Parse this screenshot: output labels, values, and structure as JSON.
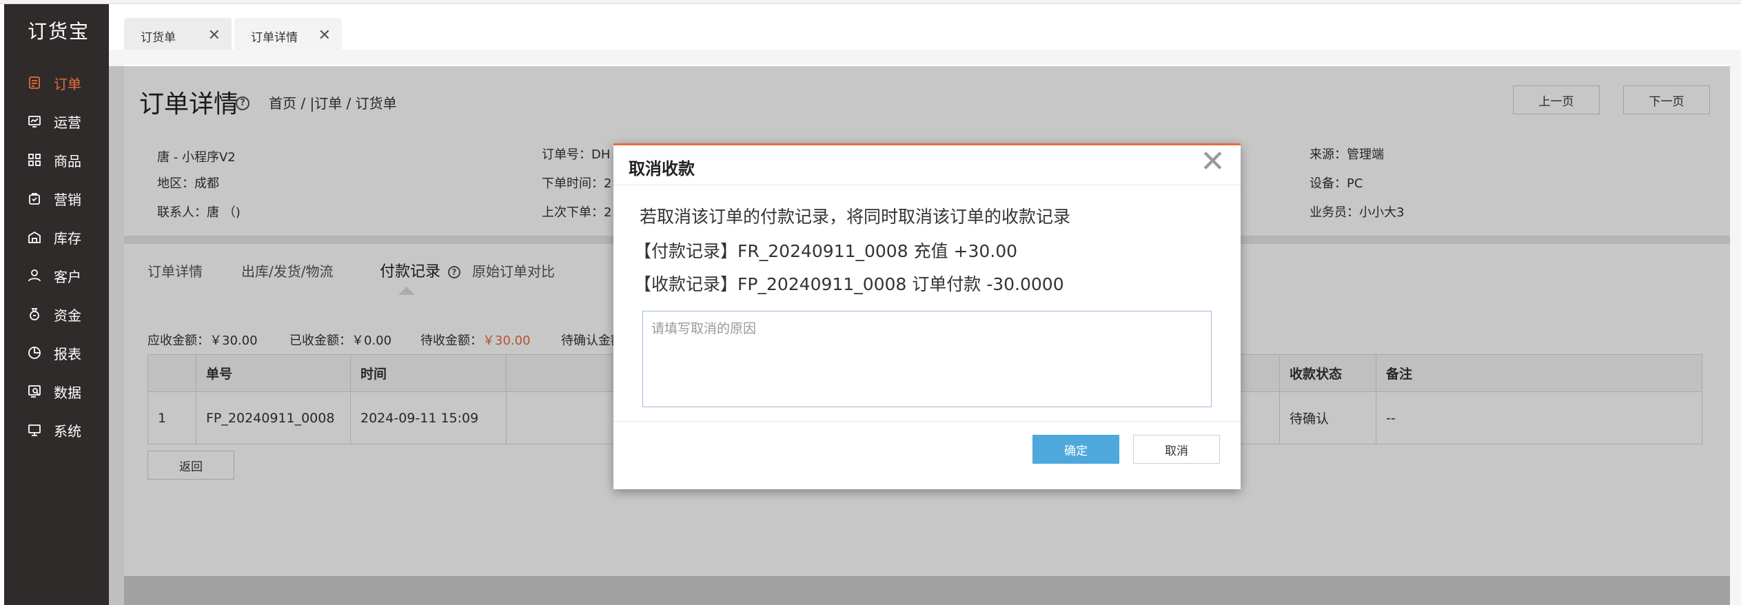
{
  "app": {
    "logo": "订货宝"
  },
  "sidebar": {
    "items": [
      {
        "label": "订单",
        "icon": "order-doc-icon",
        "active": true
      },
      {
        "label": "运营",
        "icon": "operation-chart-icon"
      },
      {
        "label": "商品",
        "icon": "product-grid-icon"
      },
      {
        "label": "营销",
        "icon": "marketing-bag-icon"
      },
      {
        "label": "库存",
        "icon": "warehouse-icon"
      },
      {
        "label": "客户",
        "icon": "customer-user-icon"
      },
      {
        "label": "资金",
        "icon": "money-bag-icon"
      },
      {
        "label": "报表",
        "icon": "report-pie-icon"
      },
      {
        "label": "数据",
        "icon": "data-search-icon"
      },
      {
        "label": "系统",
        "icon": "system-monitor-icon"
      }
    ]
  },
  "tabs": [
    {
      "label": "订货单",
      "close": "✕"
    },
    {
      "label": "订单详情",
      "close": "✕"
    }
  ],
  "page": {
    "title": "订单详情",
    "help": "?",
    "breadcrumb": "首页 / |订单 / 订货单",
    "prev_label": "上一页",
    "next_label": "下一页"
  },
  "info": {
    "customer": "唐 - 小程序V2",
    "region": "地区：成都",
    "contact": "联系人：唐 （)",
    "order_no": "订单号：DH",
    "order_time": "下单时间：2",
    "last_order": "上次下单：2",
    "source": "来源：管理端",
    "device": "设备：PC",
    "salesman": "业务员：小小大3"
  },
  "subtabs": [
    "订单详情",
    "出库/发货/物流",
    "付款记录",
    "原始订单对比"
  ],
  "summary": {
    "receivable": "应收金额：￥30.00",
    "received": "已收金额：￥0.00",
    "pending_label": "待收金额：",
    "pending_value": "￥30.00",
    "to_confirm": "待确认金额"
  },
  "table": {
    "headers": [
      "",
      "单号",
      "时间",
      "收款状态",
      "备注"
    ],
    "rows": [
      {
        "idx": "1",
        "no": "FP_20240911_0008",
        "time": "2024-09-11 15:09",
        "status": "待确认",
        "note": "--"
      }
    ]
  },
  "back_label": "返回",
  "modal": {
    "title": "取消收款",
    "close": "✕",
    "message": "若取消该订单的付款记录，将同时取消该订单的收款记录",
    "payment_record": "【付款记录】FR_20240911_0008 充值 +30.00",
    "receipt_record": "【收款记录】FP_20240911_0008 订单付款 -30.0000",
    "reason_placeholder": "请填写取消的原因",
    "reason_value": "",
    "ok_label": "确定",
    "cancel_label": "取消"
  },
  "colors": {
    "accent": "#e86a3c",
    "primary_button": "#4ea8dc",
    "sidebar_bg": "#2f2b2a"
  }
}
